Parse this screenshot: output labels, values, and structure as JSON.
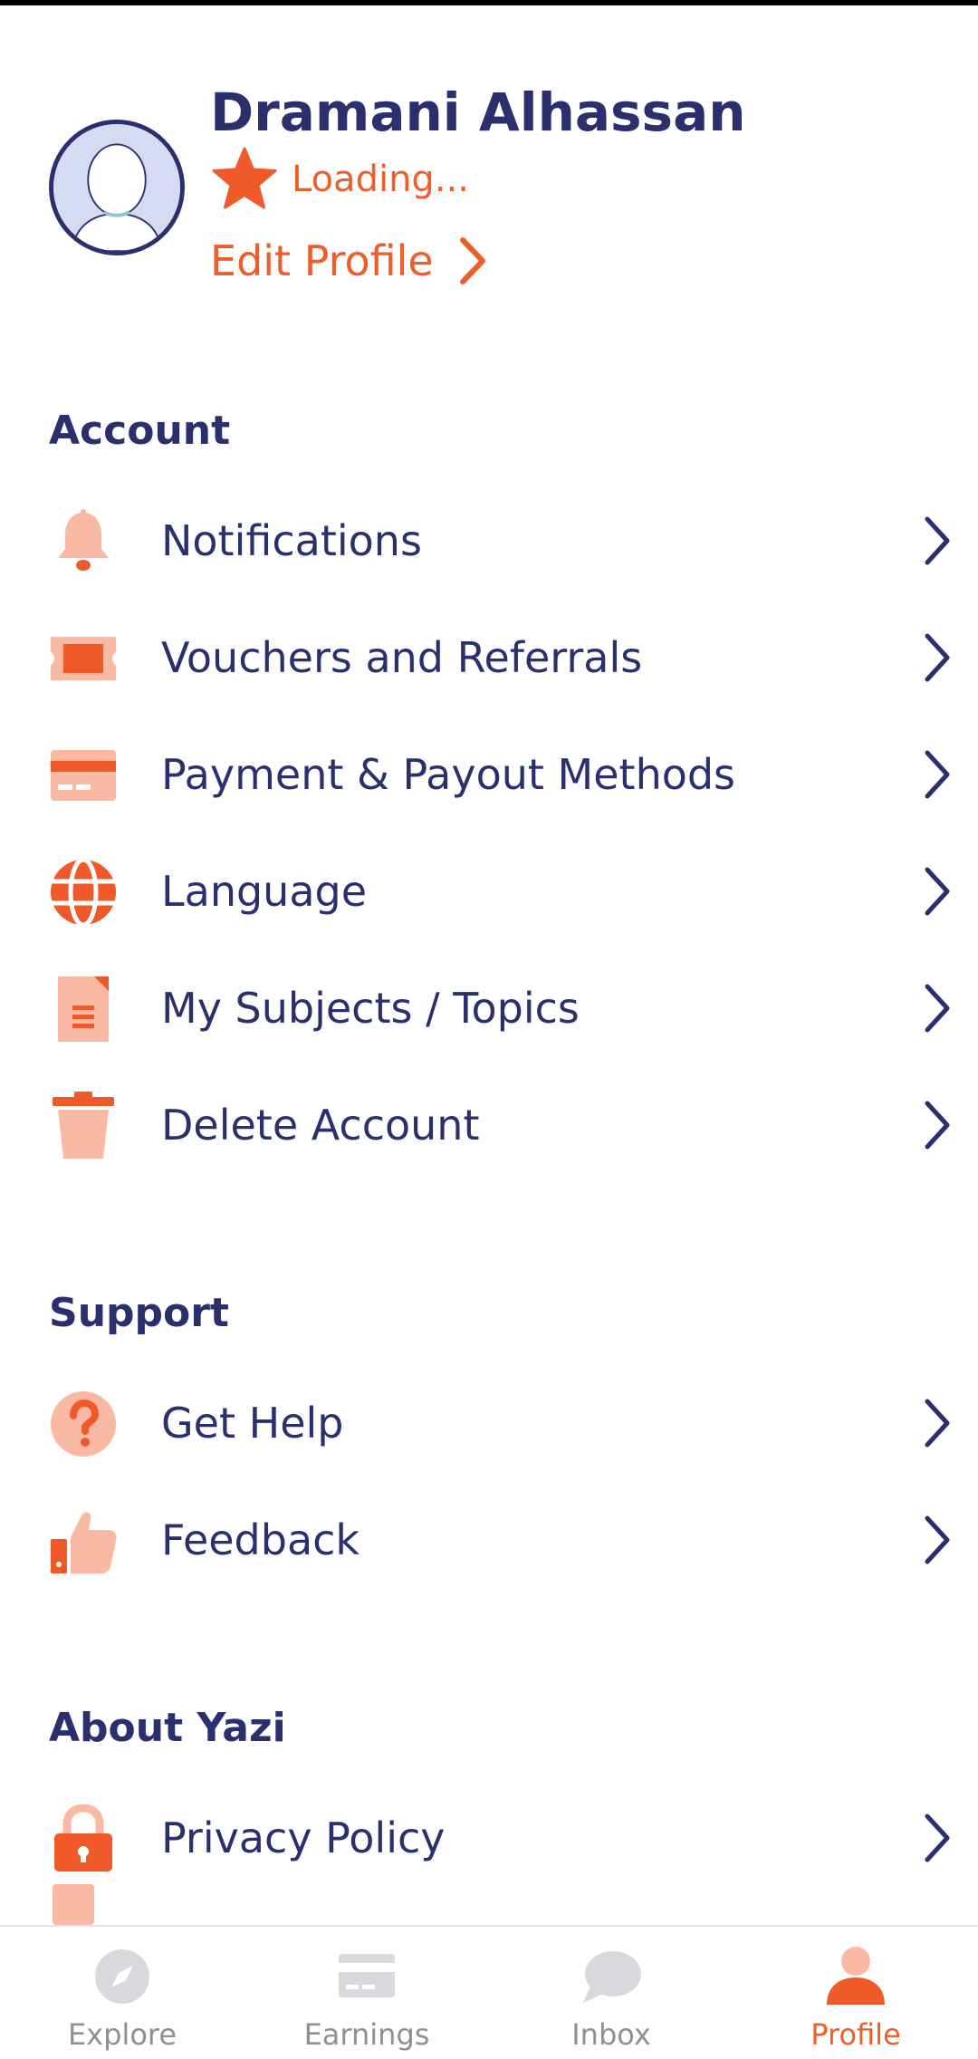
{
  "profile": {
    "name": "Dramani Alhassan",
    "rating_text": "Loading...",
    "edit_label": "Edit Profile"
  },
  "sections": {
    "account": {
      "title": "Account",
      "items": [
        {
          "label": "Notifications",
          "icon": "bell-icon"
        },
        {
          "label": "Vouchers and Referrals",
          "icon": "ticket-icon"
        },
        {
          "label": "Payment & Payout Methods",
          "icon": "credit-card-icon"
        },
        {
          "label": "Language",
          "icon": "globe-icon"
        },
        {
          "label": "My Subjects / Topics",
          "icon": "document-icon"
        },
        {
          "label": "Delete Account",
          "icon": "trash-icon"
        }
      ]
    },
    "support": {
      "title": "Support",
      "items": [
        {
          "label": "Get Help",
          "icon": "question-icon"
        },
        {
          "label": "Feedback",
          "icon": "thumbs-up-icon"
        }
      ]
    },
    "about": {
      "title": "About Yazi",
      "items": [
        {
          "label": "Privacy Policy",
          "icon": "lock-icon"
        }
      ]
    }
  },
  "bottom_nav": {
    "items": [
      {
        "label": "Explore",
        "icon": "compass-icon"
      },
      {
        "label": "Earnings",
        "icon": "card-icon"
      },
      {
        "label": "Inbox",
        "icon": "chat-bubble-icon"
      },
      {
        "label": "Profile",
        "icon": "person-icon"
      }
    ],
    "active": "Profile"
  },
  "colors": {
    "primary_text": "#2a2f6e",
    "accent": "#ec5f2a",
    "icon_light": "#f9b9a3",
    "icon_dark": "#f0592a",
    "nav_inactive": "#8f8f95"
  }
}
